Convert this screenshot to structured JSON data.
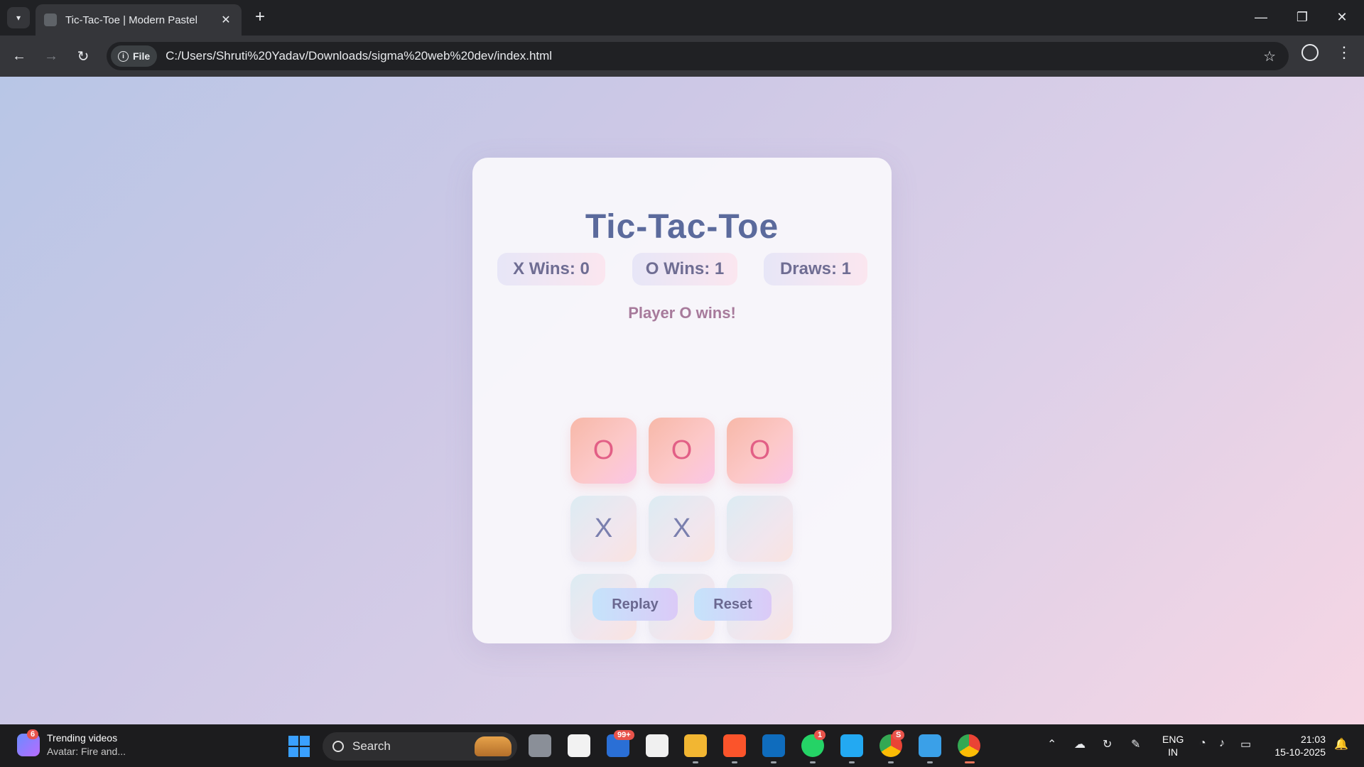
{
  "browser": {
    "tab_title": "Tic-Tac-Toe | Modern Pastel",
    "site_chip": "File",
    "url": "C:/Users/Shruti%20Yadav/Downloads/sigma%20web%20dev/index.html"
  },
  "game": {
    "title": "Tic-Tac-Toe",
    "scores": {
      "x": "X Wins: 0",
      "o": "O Wins: 1",
      "draws": "Draws: 1"
    },
    "status": "Player O wins!",
    "board": [
      "O",
      "O",
      "O",
      "X",
      "X",
      "",
      "",
      "",
      ""
    ],
    "winning_cells": [
      0,
      1,
      2
    ],
    "buttons": {
      "replay": "Replay",
      "reset": "Reset"
    }
  },
  "taskbar": {
    "widget_badge": "6",
    "widget_title": "Trending videos",
    "widget_subtitle": "Avatar: Fire and...",
    "search_label": "Search",
    "outlook_badge": "99+",
    "whatsapp_badge": "1",
    "chrome_profile_badge": "S",
    "language_line1": "ENG",
    "language_line2": "IN",
    "time": "21:03",
    "date": "15-10-2025"
  },
  "colors": {
    "title": "#5b6a9c",
    "status": "#a77a9b",
    "win_mark": "#e25f86",
    "normal_mark": "#7a7fae"
  }
}
